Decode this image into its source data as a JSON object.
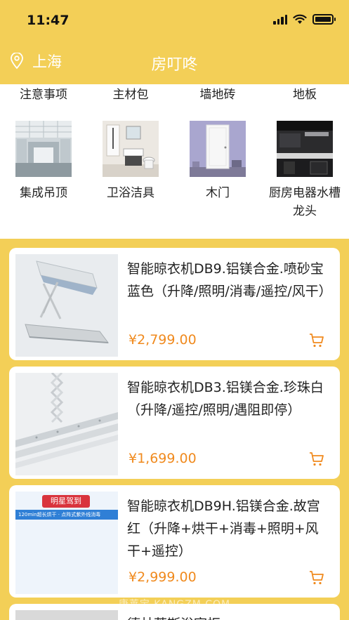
{
  "status_bar": {
    "time": "11:47"
  },
  "nav": {
    "location": "上海",
    "title": "房叮咚"
  },
  "categories_top": [
    "注意事项",
    "主材包",
    "墙地砖",
    "地板"
  ],
  "categories": [
    {
      "label": "集成吊顶",
      "image": "ceiling"
    },
    {
      "label": "卫浴洁具",
      "image": "bathroom"
    },
    {
      "label": "木门",
      "image": "door"
    },
    {
      "label": "厨房电器水槽龙头",
      "image": "kitchen"
    }
  ],
  "products": [
    {
      "title": "智能晾衣机DB9.铝镁合金.喷砂宝蓝色（升降/照明/消毒/遥控/风干）",
      "price": "¥2,799.00"
    },
    {
      "title": "智能晾衣机DB3.铝镁合金.珍珠白 （升降/遥控/照明/遇阻即停）",
      "price": "¥1,699.00"
    },
    {
      "title": "智能晾衣机DB9H.铝镁合金.故宫红（升降+烘干+消毒+照明+风干+遥控）",
      "price": "¥2,999.00",
      "badge": "明星驾到",
      "promo": "120min超长烘干 · 点阵式紫外线消毒"
    }
  ],
  "partial_product": {
    "title": "德林蒂斯浴室柜"
  },
  "watermark": "康莱宝 KANGZM.COM",
  "colors": {
    "theme_yellow": "#f3cf57",
    "price_orange": "#f08a1e"
  }
}
